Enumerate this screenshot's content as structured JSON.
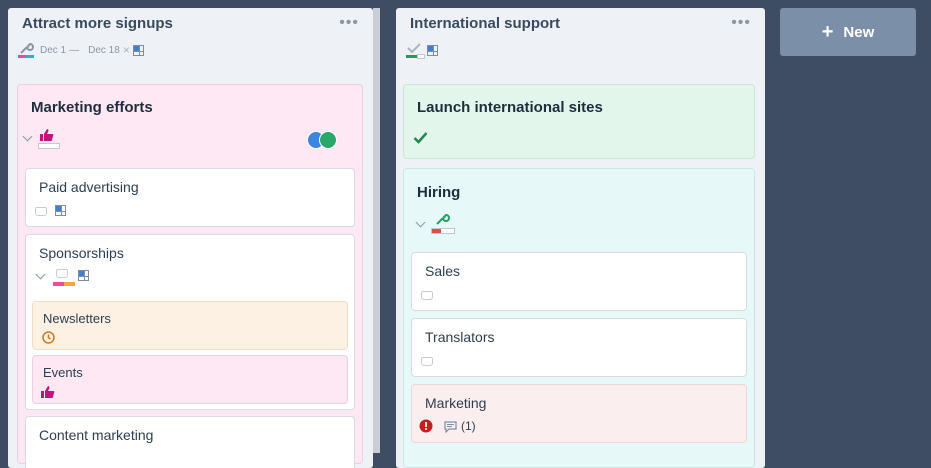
{
  "columns": [
    {
      "title": "Attract more signups",
      "date_start": "Dec 1",
      "date_end": "Dec 18",
      "cards": {
        "marketing_efforts": "Marketing efforts",
        "paid_advertising": "Paid advertising",
        "sponsorships": "Sponsorships",
        "newsletters": "Newsletters",
        "events": "Events",
        "content_marketing": "Content marketing"
      }
    },
    {
      "title": "International support",
      "cards": {
        "launch_sites": "Launch international sites",
        "hiring": "Hiring",
        "sales": "Sales",
        "translators": "Translators",
        "marketing": "Marketing",
        "comment_count": "(1)"
      }
    }
  ],
  "new_button": {
    "icon": "+",
    "label": "New"
  },
  "icons": {
    "wrench": "wrench-icon",
    "thumbs_up": "thumbs-up-icon",
    "inbox": "inbox-icon",
    "board": "board-icon",
    "check": "check-icon",
    "clock": "clock-icon",
    "alert": "alert-icon",
    "comment": "comment-icon"
  },
  "colors": {
    "background": "#3f4d62",
    "column": "#eef2f6",
    "pink": "#fde8f3",
    "green": "#e3f6ec",
    "cyan": "#e7f8f8",
    "orange": "#fdf1e4",
    "red": "#fbeeee",
    "accent_magenta": "#c0157e"
  }
}
